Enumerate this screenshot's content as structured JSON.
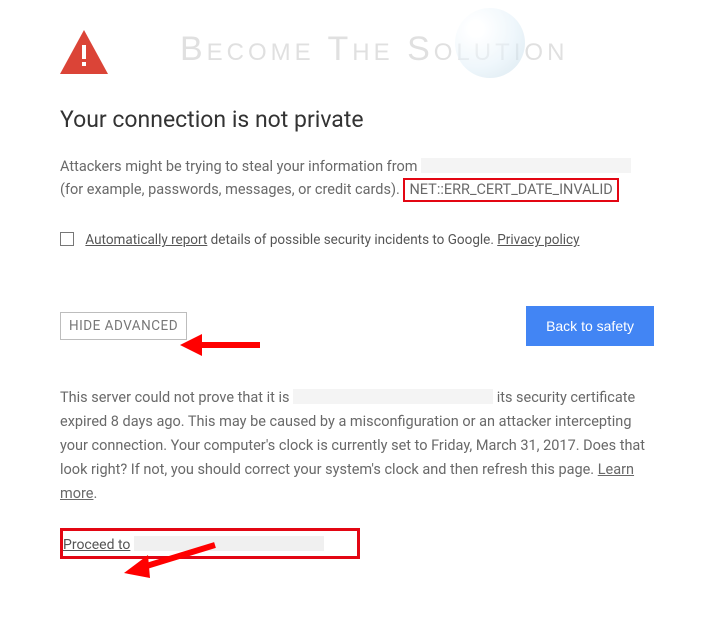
{
  "watermark": "Become The Solution",
  "heading": "Your connection is not private",
  "warn_line1_a": "Attackers might be trying to steal your information from ",
  "warn_line2_a": "(for example, passwords, messages, or credit cards).",
  "error_code": "NET::ERR_CERT_DATE_INVALID",
  "report": {
    "auto_label": "Automatically report",
    "rest": " details of possible security incidents to Google. ",
    "privacy": "Privacy policy"
  },
  "buttons": {
    "hide_advanced": "HIDE ADVANCED",
    "back_to_safety": "Back to safety"
  },
  "advanced": {
    "line_a": "This server could not prove that it is ",
    "line_b": " its security certificate expired 8 days ago. This may be caused by a misconfiguration or an attacker intercepting your connection. Your computer's clock is currently set to Friday, March 31, 2017. Does that look right? If not, you should correct your system's clock and then refresh this page. ",
    "learn_more": "Learn more",
    "dot": "."
  },
  "proceed": "Proceed to"
}
